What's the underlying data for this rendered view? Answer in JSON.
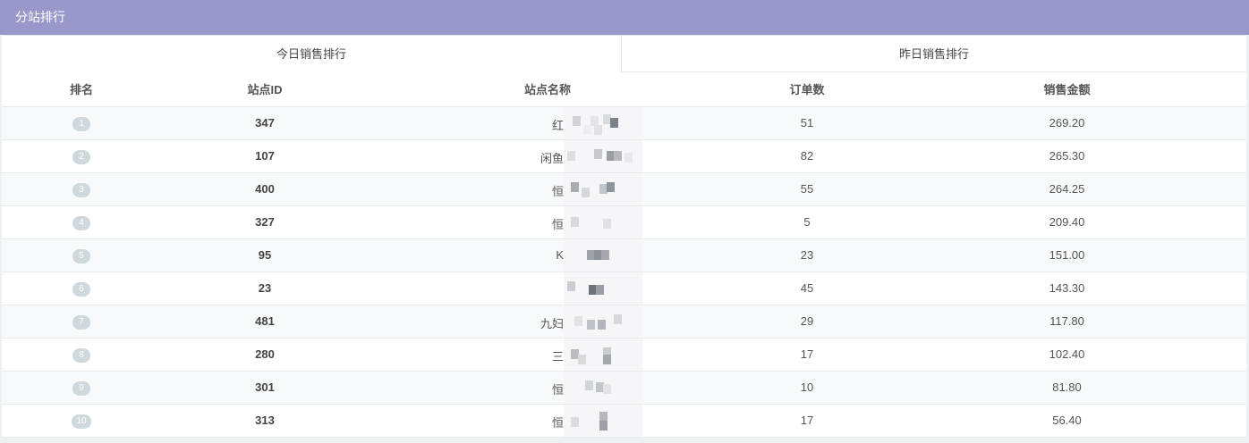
{
  "panel": {
    "title": "分站排行"
  },
  "tabs": [
    {
      "label": "今日销售排行",
      "active": true
    },
    {
      "label": "昨日销售排行",
      "active": false
    }
  ],
  "table": {
    "columns": [
      "排名",
      "站点ID",
      "站点名称",
      "订单数",
      "销售金额"
    ],
    "rows": [
      {
        "rank": "1",
        "site_id": "347",
        "name": "红",
        "orders": "51",
        "amount": "269.20"
      },
      {
        "rank": "2",
        "site_id": "107",
        "name": "闲鱼",
        "orders": "82",
        "amount": "265.30"
      },
      {
        "rank": "3",
        "site_id": "400",
        "name": "恒",
        "orders": "55",
        "amount": "264.25"
      },
      {
        "rank": "4",
        "site_id": "327",
        "name": "恒",
        "orders": "5",
        "amount": "209.40"
      },
      {
        "rank": "5",
        "site_id": "95",
        "name": "K",
        "orders": "23",
        "amount": "151.00"
      },
      {
        "rank": "6",
        "site_id": "23",
        "name": "",
        "orders": "45",
        "amount": "143.30"
      },
      {
        "rank": "7",
        "site_id": "481",
        "name": "九妇",
        "orders": "29",
        "amount": "117.80"
      },
      {
        "rank": "8",
        "site_id": "280",
        "name": "三",
        "orders": "17",
        "amount": "102.40"
      },
      {
        "rank": "9",
        "site_id": "301",
        "name": "恒",
        "orders": "10",
        "amount": "81.80"
      },
      {
        "rank": "10",
        "site_id": "313",
        "name": "恒",
        "orders": "17",
        "amount": "56.40"
      }
    ]
  },
  "colors": {
    "header_bg": "#9a98cb",
    "badge_bg": "#cfd8dc"
  }
}
